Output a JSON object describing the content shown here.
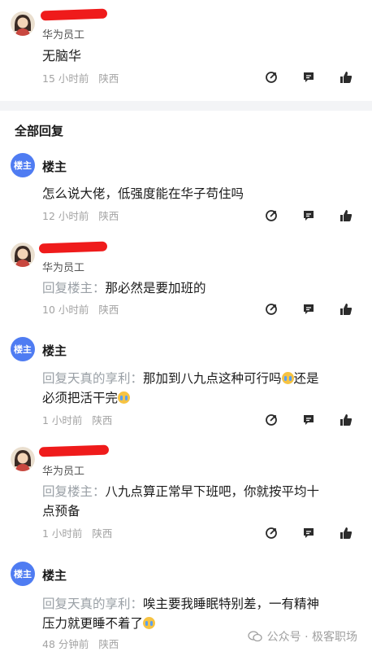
{
  "posts": [
    {
      "avatar": "cartoon-woman-avatar",
      "badge": "华为员工",
      "content": "无脑华",
      "time": "15 小时前",
      "location": "陕西"
    }
  ],
  "section_title": "全部回复",
  "replies": [
    {
      "avatar_text": "楼主",
      "name": "楼主",
      "content": "怎么说大佬，低强度能在华子苟住吗",
      "time": "12 小时前",
      "location": "陕西"
    },
    {
      "badge": "华为员工",
      "reply_prefix": "回复楼主：",
      "content": "那必然是要加班的",
      "time": "10 小时前",
      "location": "陕西"
    },
    {
      "avatar_text": "楼主",
      "name": "楼主",
      "reply_prefix": "回复天真的享利：",
      "content_line1": "那加到八九点这种可行吗",
      "content_line1_tail": "还是",
      "content_line2": "必须把活干完",
      "time": "1 小时前",
      "location": "陕西"
    },
    {
      "badge": "华为员工",
      "reply_prefix": "回复楼主：",
      "content_line1": "八九点算正常早下班吧，你就按平均十",
      "content_line2": "点预备",
      "time": "1 小时前",
      "location": "陕西"
    },
    {
      "avatar_text": "楼主",
      "name": "楼主",
      "reply_prefix": "回复天真的享利：",
      "content_line1": "唉主要我睡眠特别差，一有精神",
      "content_line2": "压力就更睡不着了",
      "time": "48 分钟前",
      "location": "陕西"
    }
  ],
  "icons": [
    "share-icon",
    "comment-icon",
    "like-icon"
  ],
  "watermark": "公众号 · 极客职场",
  "colors": {
    "accent": "#4f7cf2",
    "redaction": "#ef1b1b",
    "meta": "#a3a3a3"
  }
}
